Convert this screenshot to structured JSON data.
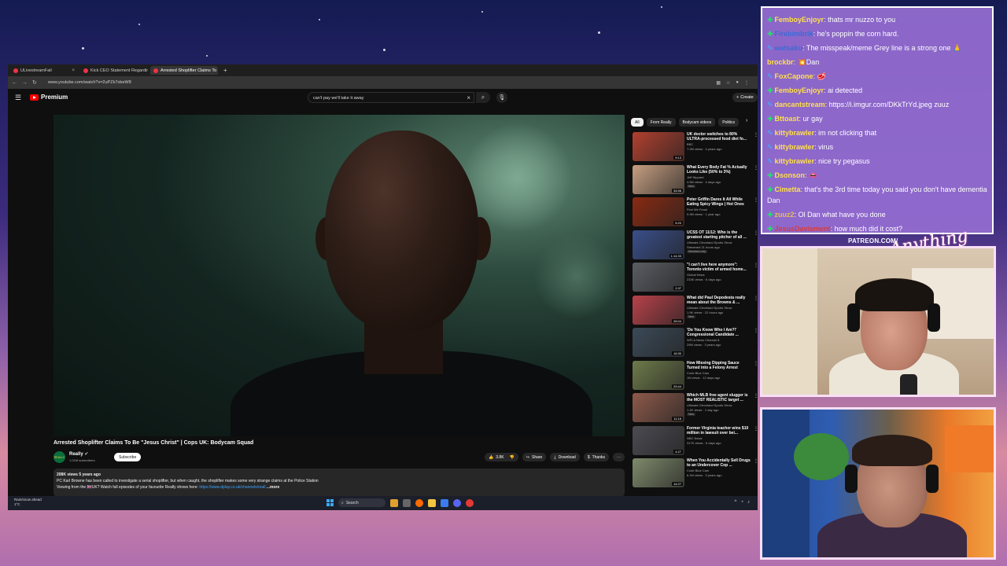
{
  "browser": {
    "tabs": [
      {
        "label": "ULivestreamFail",
        "active": false
      },
      {
        "label": "Kick CEO Statement Regarding",
        "active": false
      },
      {
        "label": "Arrested Shoplifter Claims To B",
        "active": true
      }
    ],
    "url": "www.youtube.com/watch?v=2uPZk7obeW8"
  },
  "youtube": {
    "logo_text": "Premium",
    "search_value": "can't pay we'll take it away",
    "create_label": "Create",
    "video_title": "Arrested Shoplifter Claims To Be \"Jesus Christ\" | Cops UK: Bodycam Squad",
    "channel": {
      "name": "Really",
      "subscribers": "1.01M subscribers",
      "avatar_text": "REALLY"
    },
    "subscribe_label": "Subscribe",
    "actions": {
      "likes": "3.8K",
      "share": "Share",
      "download": "Download",
      "thanks": "Thanks"
    },
    "description": {
      "meta": "208K views  5 years ago",
      "line1": "PC Karl Browne has been called to investigate a serial shoplifter, but when caught, the shoplifter makes some very strange claims at the Police Station",
      "line2_prefix": "Viewing from the 🇬🇧UK? Watch full episodes of your favourite Really shows here: ",
      "line2_link": "https://www.dplay.co.uk/channels/reall",
      "more": "...more"
    },
    "chips": [
      "All",
      "From Really",
      "Bodycam videos",
      "Politics"
    ],
    "recommendations": [
      {
        "title": "UK doctor switches to 80% ULTRA-processed food diet fo...",
        "channel": "BBC",
        "meta": "7.2M views · 4 years ago",
        "badge": "",
        "duration": "9:13",
        "thumb_color": "#b2402f"
      },
      {
        "title": "What Every Body Fat % Actually Looks Like (50% to 3%)",
        "channel": "Jeff Nippard",
        "meta": "4.5M views · 4 days ago",
        "badge": "New",
        "duration": "34:56",
        "thumb_color": "#c69f82"
      },
      {
        "title": "Peter Griffin Dares It All While Eating Spicy Wings | Hot Ones",
        "channel": "First We Feast",
        "meta": "9.9M views · 1 year ago",
        "badge": "",
        "duration": "5:20",
        "thumb_color": "#8a2a12"
      },
      {
        "title": "UCSS OT 11/12: Who is the greatest starting pitcher of all ...",
        "channel": "Ultimate Cleveland Sports Show",
        "meta": "Streamed 21 hours ago",
        "badge": "Members only",
        "duration": "1:14:33",
        "thumb_color": "#3a4f8a"
      },
      {
        "title": "\"I can't live here anymore\": Toronto victim of armed home...",
        "channel": "Global News",
        "meta": "233K views · 6 days ago",
        "badge": "",
        "duration": "2:37",
        "thumb_color": "#5a5d63"
      },
      {
        "title": "What did Paul Depodesta really mean about the Browns & ...",
        "channel": "Ultimate Cleveland Sports Show",
        "meta": "1.9K views · 22 hours ago",
        "badge": "New",
        "duration": "26:04",
        "thumb_color": "#b8424a"
      },
      {
        "title": "'Do You Know Who I Am?!' Congressional Candidate ...",
        "channel": "WFLA News Channel 8",
        "meta": "29M views · 3 years ago",
        "badge": "",
        "duration": "16:30",
        "thumb_color": "#3b4a58"
      },
      {
        "title": "How Missing Dipping Sauce Turned into a Felony Arrest",
        "channel": "Code Blue Cam",
        "meta": "1M views · 12 days ago",
        "badge": "",
        "duration": "29:44",
        "thumb_color": "#6d7a4a"
      },
      {
        "title": "Which MLB free agent slugger is the MOST REALISTIC target ...",
        "channel": "Ultimate Cleveland Sports Show",
        "meta": "1.2K views · 1 day ago",
        "badge": "New",
        "duration": "11:16",
        "thumb_color": "#8e5a4b"
      },
      {
        "title": "Former Virginia teacher wins $10 million in lawsuit over bei...",
        "channel": "NBC News",
        "meta": "317K views · 6 days ago",
        "badge": "",
        "duration": "4:27",
        "thumb_color": "#4b4b52"
      },
      {
        "title": "When You Accidentally Sell Drugs to an Undercover Cop ...",
        "channel": "Code Blue Cam",
        "meta": "6.1M views · 3 years ago",
        "badge": "",
        "duration": "14:27",
        "thumb_color": "#7e8a6b"
      }
    ]
  },
  "taskbar": {
    "weather_line1": "Rain/snow ahead",
    "weather_line2": "1°C",
    "search_label": "Search"
  },
  "chat": {
    "messages": [
      {
        "user": "FemboyEnjoyr",
        "user_color": "#ffe04a",
        "text": "thats mr nuzzo to you",
        "badge": "green"
      },
      {
        "user": "Firebimbrik",
        "user_color": "#3b6bd8",
        "text": "he's poppin the corn hard.",
        "badge": "green"
      },
      {
        "user": "watsaku",
        "user_color": "#3b6bd8",
        "text": "The misspeak/meme Grey line is a strong one 🙏",
        "badge": "blue"
      },
      {
        "user": "brockbr",
        "user_color": "#ffe04a",
        "text": "💥Dan",
        "badge": ""
      },
      {
        "user": "FoxCapone",
        "user_color": "#ffe04a",
        "text": "🥩",
        "badge": "blue"
      },
      {
        "user": "FemboyEnjoyr",
        "user_color": "#ffe04a",
        "text": "ai detected",
        "badge": "green"
      },
      {
        "user": "dancantstream",
        "user_color": "#ffe04a",
        "text": "https://i.imgur.com/DKkTrYd.jpeg zuuz",
        "badge": "blue"
      },
      {
        "user": "Bttoast",
        "user_color": "#ffe04a",
        "text": "ur gay",
        "badge": "green"
      },
      {
        "user": "kittybrawler",
        "user_color": "#ffe04a",
        "text": "im not clicking that",
        "badge": "blue"
      },
      {
        "user": "kittybrawler",
        "user_color": "#ffe04a",
        "text": "virus",
        "badge": "blue"
      },
      {
        "user": "kittybrawler",
        "user_color": "#ffe04a",
        "text": "nice try pegasus",
        "badge": "blue"
      },
      {
        "user": "Dsonson",
        "user_color": "#ffe04a",
        "text": "👄",
        "badge": "green"
      },
      {
        "user": "Cimetta",
        "user_color": "#ffe04a",
        "text": "that's the 3rd time today you said you don't have dementia Dan",
        "badge": "green",
        "wrap": true
      },
      {
        "user": "zuuz2",
        "user_color": "#e8c04a",
        "text": "Ol Dan what have you done",
        "badge": "green"
      },
      {
        "user": "JesusDavisment",
        "user_color": "#d83b3b",
        "text": "how much did it cost?",
        "badge": "green"
      }
    ]
  },
  "overlay": {
    "patreon": "PATREON.COM/",
    "logo": "Anything Else"
  }
}
